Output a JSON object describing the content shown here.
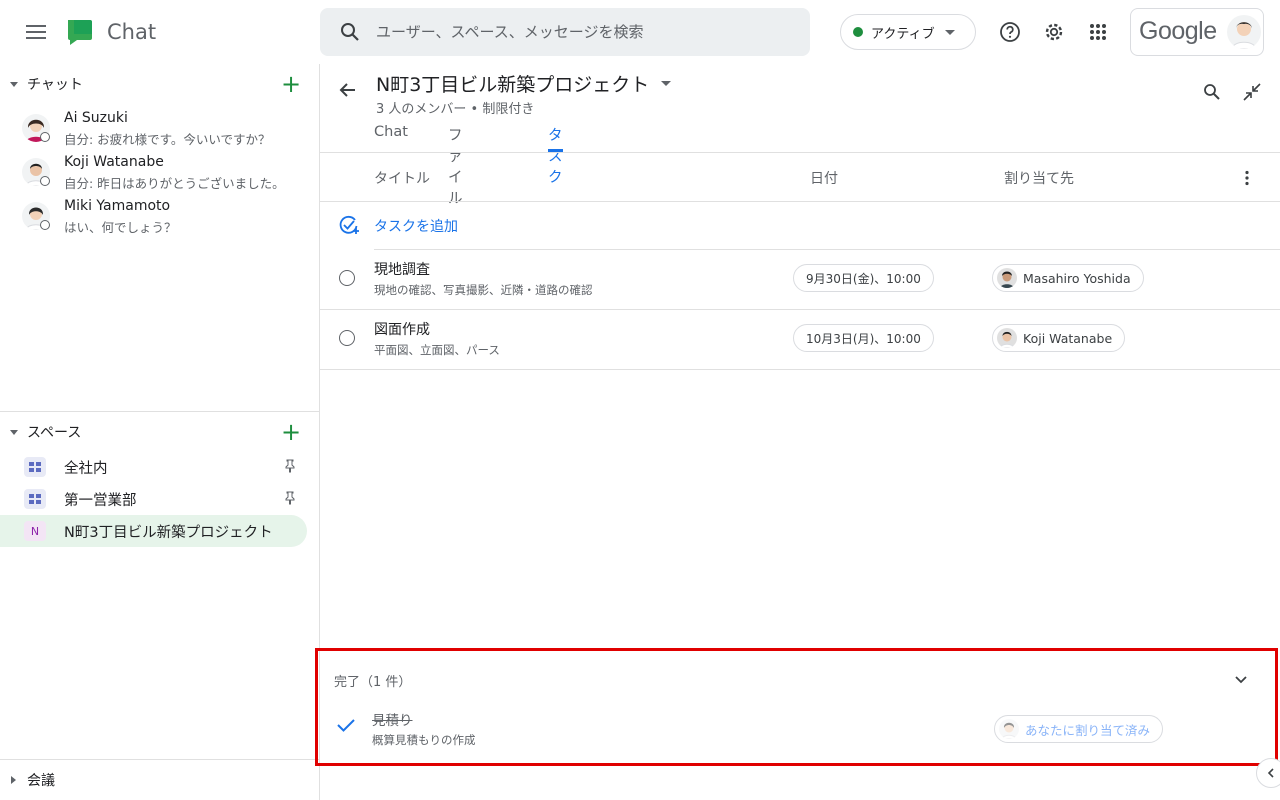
{
  "app": {
    "name": "Chat"
  },
  "search": {
    "placeholder": "ユーザー、スペース、メッセージを検索"
  },
  "status": {
    "label": "アクティブ",
    "color": "#1e8e3e"
  },
  "account": {
    "brand": "Google"
  },
  "sidebar": {
    "chat_section": "チャット",
    "chats": [
      {
        "name": "Ai Suzuki",
        "preview": "自分: お疲れ様です。今いいですか？"
      },
      {
        "name": "Koji Watanabe",
        "preview": "自分: 昨日はありがとうございました。"
      },
      {
        "name": "Miki Yamamoto",
        "preview": "はい、何でしょう？"
      }
    ],
    "space_section": "スペース",
    "spaces": [
      {
        "name": "全社内",
        "pinned": true
      },
      {
        "name": "第一営業部",
        "pinned": true
      },
      {
        "name": "N町3丁目ビル新築プロジェクト",
        "initial": "N",
        "active": true
      }
    ],
    "meet_section": "会議"
  },
  "room": {
    "title": "N町3丁目ビル新築プロジェクト",
    "subtitle": "3 人のメンバー • 制限付き",
    "tabs": [
      "Chat",
      "ファイル",
      "タスク"
    ],
    "active_tab": "タスク"
  },
  "tasks": {
    "columns": {
      "title": "タイトル",
      "date": "日付",
      "assignee": "割り当て先"
    },
    "add_label": "タスクを追加",
    "items": [
      {
        "title": "現地調査",
        "desc": "現地の確認、写真撮影、近隣・道路の確認",
        "date": "9月30日(金)、10:00",
        "assignee": "Masahiro Yoshida"
      },
      {
        "title": "図面作成",
        "desc": "平面図、立面図、パース",
        "date": "10月3日(月)、10:00",
        "assignee": "Koji Watanabe"
      }
    ],
    "completed_header": "完了（1 件）",
    "completed": [
      {
        "title": "見積り",
        "desc": "概算見積もりの作成",
        "assignee": "あなたに割り当て済み"
      }
    ]
  }
}
